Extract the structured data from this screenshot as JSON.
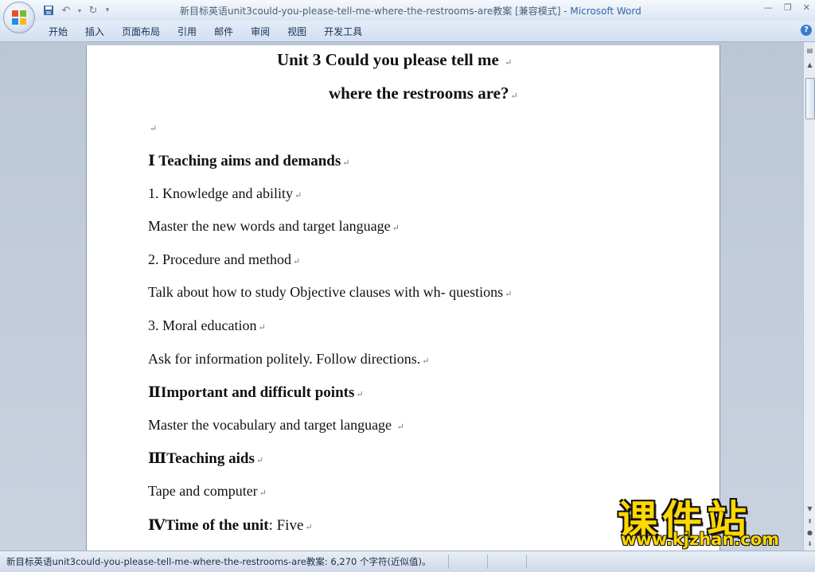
{
  "window": {
    "title": "新目标英语unit3could-you-please-tell-me-where-the-restrooms-are教案 [兼容模式] - ",
    "app_name": "Microsoft Word"
  },
  "quick_access": {
    "save_icon": "save-icon",
    "undo_icon": "undo-icon",
    "redo_icon": "redo-icon"
  },
  "ribbon": {
    "tabs": [
      "开始",
      "插入",
      "页面布局",
      "引用",
      "邮件",
      "审阅",
      "视图",
      "开发工具"
    ],
    "help": "?"
  },
  "document": {
    "title_line1": "Unit 3 Could you please tell me",
    "title_line2": "where the restrooms are?",
    "para_mark": "↵",
    "lines": [
      {
        "text": "Ⅰ Teaching aims and demands",
        "style": "bold"
      },
      {
        "text": "1. Knowledge and ability",
        "style": "normal"
      },
      {
        "text": "Master the new words and target language",
        "style": "normal"
      },
      {
        "text": "2. Procedure and method",
        "style": "normal"
      },
      {
        "text": "Talk about how to study Objective clauses with wh- questions",
        "style": "normal"
      },
      {
        "text": "3. Moral education",
        "style": "normal"
      },
      {
        "text": "Ask for information politely.    Follow directions.",
        "style": "normal"
      },
      {
        "text": "ⅡImportant  and difficult  points",
        "style": "bold"
      },
      {
        "text": "Master the vocabulary and target language  ",
        "style": "normal"
      },
      {
        "text": "ⅢTeaching aids",
        "style": "bold"
      },
      {
        "text": "Tape and computer",
        "style": "normal"
      },
      {
        "text": "ⅣTime of the unit",
        "style": "bold",
        "suffix": ": Five"
      }
    ]
  },
  "watermark": {
    "text_cn": "课件站",
    "url": "www.kjzhan.com"
  },
  "statusbar": {
    "text": "新目标英语unit3could-you-please-tell-me-where-the-restrooms-are教案: 6,270 个字符(近似值)。"
  },
  "colors": {
    "accent": "#3565a8",
    "watermark": "#ffd800"
  }
}
